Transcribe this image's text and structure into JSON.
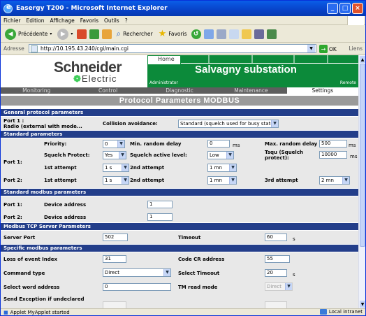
{
  "window": {
    "title": "Easergy T200 - Microsoft Internet Explorer"
  },
  "menu": [
    "Fichier",
    "Edition",
    "Affichage",
    "Favoris",
    "Outils",
    "?"
  ],
  "toolbar": {
    "back": "Précédente",
    "search": "Rechercher",
    "favorites": "Favoris"
  },
  "address": {
    "label": "Adresse",
    "url": "http://10.195.43.240/cgi/main.cgi",
    "go": "OK",
    "links": "Liens"
  },
  "brand": {
    "line1": "Schneider",
    "line2": "Electric"
  },
  "header": {
    "home": "Home",
    "site": "Salvagny substation",
    "user": "Administrator",
    "mode": "Remote"
  },
  "nav": {
    "tabs": [
      "Monitoring",
      "Control",
      "Diagnostic",
      "Maintenance",
      "Settings"
    ],
    "active": "Settings"
  },
  "page_title": "Protocol Parameters  MODBUS",
  "general": {
    "heading": "General protocol parameters",
    "port_label": "Port 1 :\nRadio (external with mode...",
    "collision_label": "Collision avoidance:",
    "collision_value": "Standard (squelch used for busy state)"
  },
  "standard": {
    "heading": "Standard parameters",
    "priority_label": "Priority:",
    "priority_value": "0",
    "min_delay_label": "Min. random delay",
    "min_delay_value": "0",
    "min_delay_unit": "ms",
    "max_delay_label": "Max. random delay",
    "max_delay_value": "500",
    "max_delay_unit": "ms",
    "port1_label": "Port 1:",
    "squelch_protect_label": "Squelch Protect:",
    "squelch_protect_value": "Yes",
    "squelch_level_label": "Squelch active level:",
    "squelch_level_value": "Low",
    "tsqu_label": "Tsqu (Squelch protect):",
    "tsqu_value": "10000",
    "tsqu_unit": "ms",
    "p1_first_label": "1st attempt",
    "p1_first_value": "1 s",
    "p1_second_label": "2nd attempt",
    "p1_second_value": "1 mn",
    "port2_label": "Port 2:",
    "p2_first_label": "1st attempt",
    "p2_first_value": "1 s",
    "p2_second_label": "2nd attempt",
    "p2_second_value": "1 mn",
    "p2_third_label": "3rd attempt",
    "p2_third_value": "2 mn"
  },
  "std_modbus": {
    "heading": "Standard modbus parameters",
    "port1_label": "Port 1:",
    "port1_dev_label": "Device address",
    "port1_dev_value": "1",
    "port2_label": "Port 2:",
    "port2_dev_label": "Device address",
    "port2_dev_value": "1"
  },
  "tcp": {
    "heading": "Modbus TCP Server Parameters",
    "server_port_label": "Server Port",
    "server_port_value": "502",
    "timeout_label": "Timeout",
    "timeout_value": "60",
    "timeout_unit": "s"
  },
  "specific": {
    "heading": "Specific modbus parameters",
    "loss_label": "Loss of event Index",
    "loss_value": "31",
    "code_cr_label": "Code CR address",
    "code_cr_value": "55",
    "cmd_type_label": "Command type",
    "cmd_type_value": "Direct",
    "sel_timeout_label": "Select Timeout",
    "sel_timeout_value": "20",
    "sel_timeout_unit": "s",
    "sel_word_label": "Select word address",
    "sel_word_value": "0",
    "tm_read_label": "TM read mode",
    "tm_read_value": "Direct",
    "send_exc_label": "Send Exception if undeclared"
  },
  "status": {
    "left": "Applet MyApplet started",
    "zone": "Local intranet"
  }
}
